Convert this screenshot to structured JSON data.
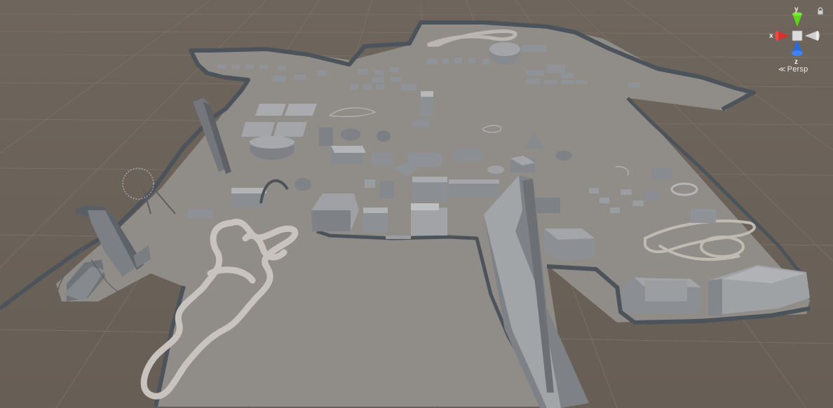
{
  "viewport": {
    "background": "#6b6259",
    "grid_color": "#7a7168",
    "ground_color": "#918e8a",
    "wall_color": "#4c535b"
  },
  "gizmo": {
    "y_label": "y",
    "x_label": "x",
    "z_label": "z",
    "projection_label": "Persp",
    "projection_icon": "perspective-lines-icon",
    "lock_icon": "lock-icon",
    "colors": {
      "x": "#d9312b",
      "y": "#5fd31b",
      "z": "#2b6bd9",
      "neutral": "#cfcfcf"
    }
  }
}
